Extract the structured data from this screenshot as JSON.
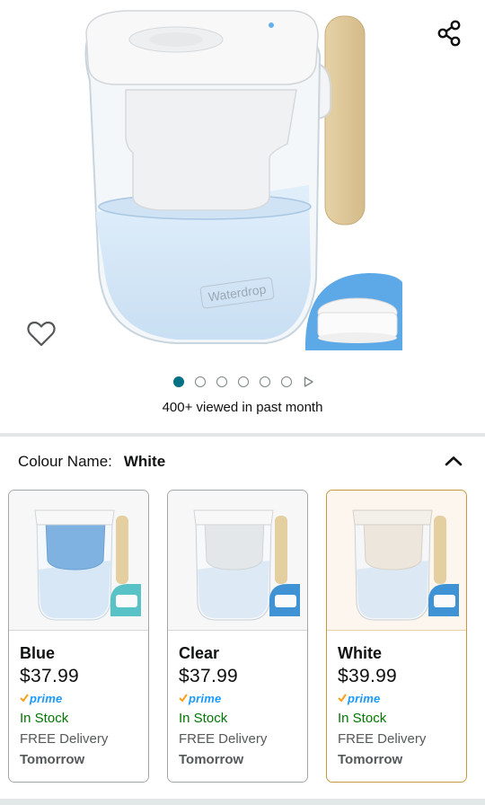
{
  "product": {
    "brand_text": "Waterdrop",
    "viewed_text": "400+ viewed in past month"
  },
  "carousel": {
    "total_dots": 6,
    "active_index": 0
  },
  "colour": {
    "label": "Colour Name:",
    "value": "White"
  },
  "variants": [
    {
      "name": "Blue",
      "price": "$37.99",
      "prime": "prime",
      "stock": "In Stock",
      "delivery": "FREE Delivery",
      "when": "Tomorrow",
      "tint": "#7fb2e0",
      "selected": false
    },
    {
      "name": "Clear",
      "price": "$37.99",
      "prime": "prime",
      "stock": "In Stock",
      "delivery": "FREE Delivery",
      "when": "Tomorrow",
      "tint": "#e3e7ea",
      "selected": false
    },
    {
      "name": "White",
      "price": "$39.99",
      "prime": "prime",
      "stock": "In Stock",
      "delivery": "FREE Delivery",
      "when": "Tomorrow",
      "tint": "#ece6dd",
      "selected": true
    }
  ],
  "colors": {
    "accent_teal": "#007185",
    "stock_green": "#007600",
    "prime_blue": "#1a98ff",
    "prime_check": "#f7a019",
    "selected_border": "#c49a3c"
  },
  "icons": {
    "share": "share-icon",
    "wishlist": "heart-icon",
    "collapse": "chevron-up-icon",
    "next": "play-icon"
  }
}
